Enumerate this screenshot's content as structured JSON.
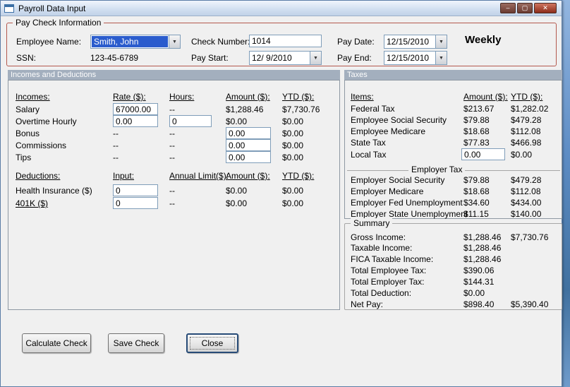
{
  "icons": {
    "minimize": "–",
    "maximize": "▢",
    "close": "✕",
    "dropdown": "▼"
  },
  "window": {
    "title": "Payroll Data Input"
  },
  "paycheck": {
    "group_title": "Pay Check Information",
    "employee_name": {
      "label": "Employee Name:",
      "value": "Smith, John"
    },
    "ssn": {
      "label": "SSN:",
      "value": "123-45-6789"
    },
    "check_number": {
      "label": "Check Number:",
      "value": "1014"
    },
    "pay_start": {
      "label": "Pay Start:",
      "value": "12/ 9/2010"
    },
    "pay_date": {
      "label": "Pay Date:",
      "value": "12/15/2010"
    },
    "pay_end": {
      "label": "Pay End:",
      "value": "12/15/2010"
    },
    "frequency": "Weekly"
  },
  "incomes_panel": {
    "header": "Incomes and Deductions",
    "income_columns": [
      "Incomes:",
      "Rate ($):",
      "Hours:",
      "Amount ($):",
      "YTD ($):"
    ],
    "income_rows": [
      {
        "name": "Salary",
        "rate": "67000.00",
        "hours": "--",
        "amount": "$1,288.46",
        "ytd": "$7,730.76"
      },
      {
        "name": "Overtime Hourly",
        "rate": "0.00",
        "hours": "0",
        "amount": "$0.00",
        "ytd": "$0.00"
      },
      {
        "name": "Bonus",
        "rate": "--",
        "hours": "--",
        "amount": "0.00",
        "ytd": "$0.00"
      },
      {
        "name": "Commissions",
        "rate": "--",
        "hours": "--",
        "amount": "0.00",
        "ytd": "$0.00"
      },
      {
        "name": "Tips",
        "rate": "--",
        "hours": "--",
        "amount": "0.00",
        "ytd": "$0.00"
      }
    ],
    "deduction_columns": [
      "Deductions:",
      "Input:",
      "Annual Limit($):",
      "Amount ($):",
      "YTD ($):"
    ],
    "deduction_rows": [
      {
        "name": "Health Insurance  ($)",
        "input": "0",
        "limit": "--",
        "amount": "$0.00",
        "ytd": "$0.00"
      },
      {
        "name": "401K  ($)",
        "input": "0",
        "limit": "--",
        "amount": "$0.00",
        "ytd": "$0.00"
      }
    ]
  },
  "taxes_panel": {
    "header": "Taxes",
    "columns": [
      "Items:",
      "Amount ($):",
      "YTD ($):"
    ],
    "employee_rows": [
      {
        "name": "Federal Tax",
        "amount": "$213.67",
        "ytd": "$1,282.02"
      },
      {
        "name": "Employee Social Security",
        "amount": "$79.88",
        "ytd": "$479.28"
      },
      {
        "name": "Employee Medicare",
        "amount": "$18.68",
        "ytd": "$112.08"
      },
      {
        "name": "State Tax",
        "amount": "$77.83",
        "ytd": "$466.98"
      },
      {
        "name": "Local Tax",
        "amount": "0.00",
        "ytd": "$0.00"
      }
    ],
    "employer_group_title": "Employer Tax",
    "employer_rows": [
      {
        "name": "Employer Social Security",
        "amount": "$79.88",
        "ytd": "$479.28"
      },
      {
        "name": "Employer Medicare",
        "amount": "$18.68",
        "ytd": "$112.08"
      },
      {
        "name": "Employer Fed Unemployment",
        "amount": "$34.60",
        "ytd": "$434.00"
      },
      {
        "name": "Employer State Unemployment",
        "amount": "$11.15",
        "ytd": "$140.00"
      }
    ]
  },
  "summary": {
    "group_title": "Summary",
    "rows": [
      {
        "name": "Gross Income:",
        "amount": "$1,288.46",
        "ytd": "$7,730.76"
      },
      {
        "name": "Taxable Income:",
        "amount": "$1,288.46",
        "ytd": ""
      },
      {
        "name": "FICA Taxable Income:",
        "amount": "$1,288.46",
        "ytd": ""
      },
      {
        "name": "Total Employee Tax:",
        "amount": "$390.06",
        "ytd": ""
      },
      {
        "name": "Total Employer Tax:",
        "amount": "$144.31",
        "ytd": ""
      },
      {
        "name": "Total Deduction:",
        "amount": "$0.00",
        "ytd": ""
      },
      {
        "name": "Net Pay:",
        "amount": "$898.40",
        "ytd": "$5,390.40"
      }
    ]
  },
  "buttons": {
    "calculate": "Calculate Check",
    "save": "Save Check",
    "close": "Close"
  }
}
